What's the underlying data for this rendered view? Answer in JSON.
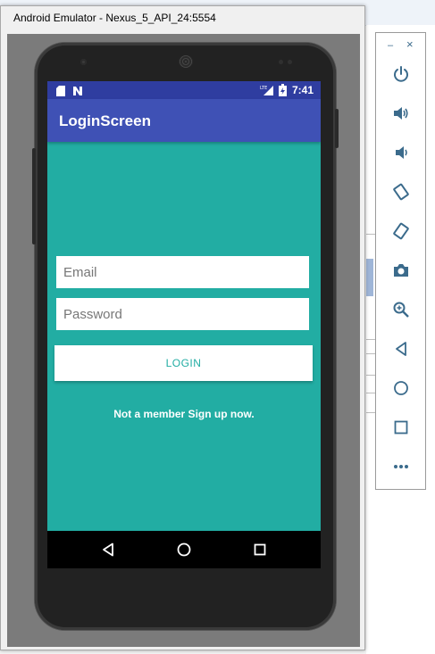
{
  "window": {
    "title": "Android Emulator - Nexus_5_API_24:5554"
  },
  "status_bar": {
    "time": "7:41",
    "icons": [
      "sd-card-icon",
      "n-notification-icon",
      "lte-signal-icon",
      "battery-icon"
    ]
  },
  "app": {
    "title": "LoginScreen",
    "email": {
      "placeholder": "Email",
      "value": ""
    },
    "password": {
      "placeholder": "Password",
      "value": ""
    },
    "login_label": "LOGIN",
    "signup_text": "Not a member Sign up now."
  },
  "nav_bar": {
    "buttons": [
      "back-triangle-icon",
      "home-circle-icon",
      "recents-square-icon"
    ]
  },
  "toolbar": {
    "minimize": "–",
    "close": "×",
    "buttons": [
      "power-icon",
      "volume-up-icon",
      "volume-down-icon",
      "rotate-left-icon",
      "rotate-right-icon",
      "camera-icon",
      "zoom-icon",
      "back-icon",
      "home-icon",
      "overview-icon",
      "more-icon"
    ]
  },
  "colors": {
    "screen_bg": "#22ada3",
    "app_bar": "#3f51b5",
    "status_bar": "#2f3da0",
    "accent": "#22ada3",
    "toolbar_icon": "#3b6b8c"
  }
}
